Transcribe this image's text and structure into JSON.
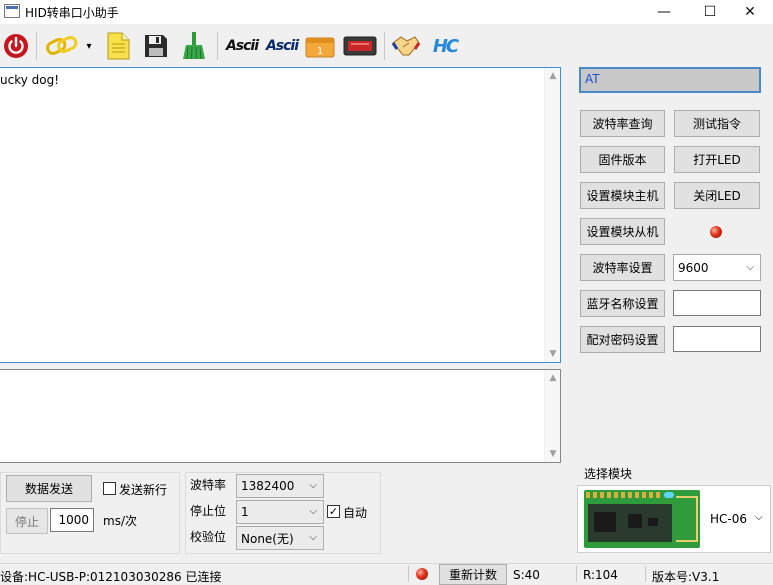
{
  "window": {
    "title": "HID转串口小助手",
    "minimize": "—",
    "maximize": "☐",
    "close": "✕"
  },
  "toolbar": {
    "ascii_label": "Ascii",
    "ascii_label2": "Ascii",
    "calendar_number": "1",
    "hc_logo": "HC",
    "dropdown_arrow": "▾"
  },
  "receive": {
    "text": "ucky dog!"
  },
  "right_panel": {
    "command_input": "AT",
    "buttons": {
      "query_baud": "波特率查询",
      "test_cmd": "测试指令",
      "firmware": "固件版本",
      "led_on": "打开LED",
      "set_master": "设置模块主机",
      "led_off": "关闭LED",
      "set_slave": "设置模块从机",
      "set_baud": "波特率设置",
      "bt_name": "蓝牙名称设置",
      "pair_pwd": "配对密码设置"
    },
    "baud_select": "9600",
    "bt_name_value": "",
    "pair_pwd_value": ""
  },
  "module": {
    "group_label": "选择模块",
    "selected": "HC-06"
  },
  "send_panel": {
    "send_button": "数据发送",
    "newline_label": "发送新行",
    "newline_checked": false,
    "stop_button": "停止",
    "interval_value": "1000",
    "interval_unit": "ms/次"
  },
  "serial_settings": {
    "baud_label": "波特率",
    "baud_value": "1382400",
    "stop_label": "停止位",
    "stop_value": "1",
    "parity_label": "校验位",
    "parity_value": "None(无)",
    "auto_label": "自动",
    "auto_checked": true
  },
  "status": {
    "device": "设备:HC-USB-P:012103030286 已连接",
    "reset_button": "重新计数",
    "sent": "S:40",
    "received": "R:104",
    "version": "版本号:V3.1"
  },
  "colors": {
    "accent": "#3c8ed6",
    "command_bg": "#c8c8c8",
    "command_text": "#1a4fd6",
    "pcb_green": "#2f9b3a",
    "led_red": "#e0301a"
  }
}
